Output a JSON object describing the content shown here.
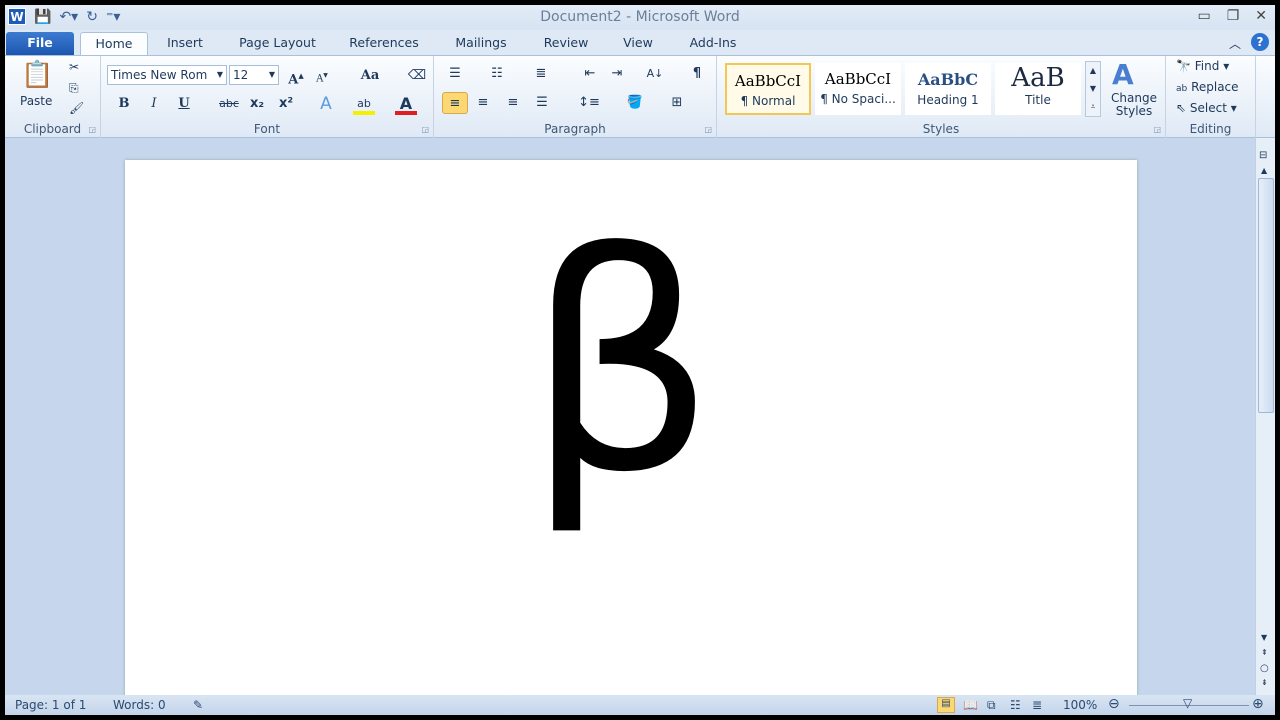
{
  "window": {
    "title": "Document2 - Microsoft Word",
    "app_icon": "W"
  },
  "qat": {
    "icons": [
      "save-icon",
      "undo-icon",
      "redo-icon",
      "customize-icon"
    ]
  },
  "tabs": [
    "File",
    "Home",
    "Insert",
    "Page Layout",
    "References",
    "Mailings",
    "Review",
    "View",
    "Add-Ins"
  ],
  "active_tab": "Home",
  "clipboard": {
    "paste": "Paste",
    "label": "Clipboard"
  },
  "font": {
    "name": "Times New Rom",
    "size": "12",
    "label": "Font",
    "change_case": "Aa",
    "bold": "B",
    "italic": "I",
    "underline": "U",
    "strike": "abc",
    "sub": "x₂",
    "sup": "x²",
    "color": "A",
    "highlight": "ab",
    "font_color": "#e02020",
    "highlight_color": "#f5f000"
  },
  "paragraph": {
    "label": "Paragraph",
    "pilcrow": "¶"
  },
  "styles": {
    "label": "Styles",
    "items": [
      {
        "preview": "AaBbCcI",
        "name": "¶ Normal"
      },
      {
        "preview": "AaBbCcI",
        "name": "¶ No Spaci..."
      },
      {
        "preview": "AaBbC",
        "name": "Heading 1"
      },
      {
        "preview": "AaB",
        "name": "Title"
      }
    ],
    "change_styles": "Change Styles"
  },
  "editing": {
    "label": "Editing",
    "find": "Find",
    "replace": "Replace",
    "select": "Select"
  },
  "document": {
    "content": "β"
  },
  "status": {
    "page": "Page: 1 of 1",
    "words": "Words: 0",
    "zoom": "100%",
    "zoom_level": 100
  }
}
